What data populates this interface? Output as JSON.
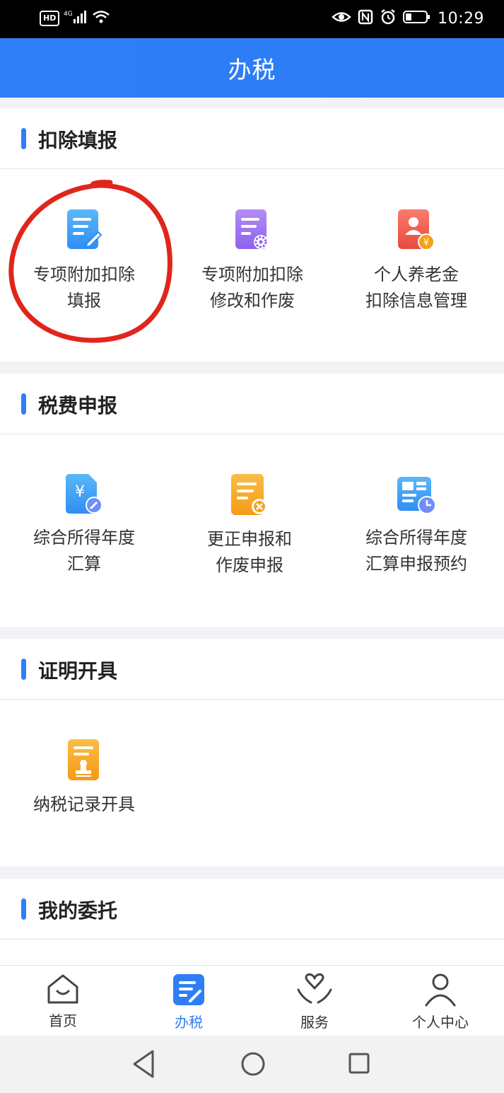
{
  "status_bar": {
    "network": "HD",
    "signal": "4G",
    "time": "10:29"
  },
  "header": {
    "title": "办税"
  },
  "sections": [
    {
      "title": "扣除填报",
      "items": [
        {
          "label": "专项附加扣除\n填报",
          "icon": "doc-edit-icon"
        },
        {
          "label": "专项附加扣除\n修改和作废",
          "icon": "doc-settings-icon"
        },
        {
          "label": "个人养老金\n扣除信息管理",
          "icon": "person-yuan-icon"
        }
      ]
    },
    {
      "title": "税费申报",
      "items": [
        {
          "label": "综合所得年度\n汇算",
          "icon": "yuan-doc-edit-icon"
        },
        {
          "label": "更正申报和\n作废申报",
          "icon": "doc-cancel-icon"
        },
        {
          "label": "综合所得年度\n汇算申报预约",
          "icon": "calendar-clock-icon"
        }
      ]
    },
    {
      "title": "证明开具",
      "items": [
        {
          "label": "纳税记录开具",
          "icon": "doc-stamp-icon"
        }
      ]
    },
    {
      "title": "我的委托",
      "items": []
    }
  ],
  "tabbar": [
    {
      "label": "首页",
      "icon": "home-icon",
      "active": false
    },
    {
      "label": "办税",
      "icon": "tax-doc-icon",
      "active": true
    },
    {
      "label": "服务",
      "icon": "service-heart-icon",
      "active": false
    },
    {
      "label": "个人中心",
      "icon": "person-icon",
      "active": false
    }
  ],
  "navbar": [
    "back-icon",
    "home-circle-icon",
    "recents-icon"
  ],
  "colors": {
    "accent": "#2e7ef7",
    "annotation": "#e0261c"
  }
}
